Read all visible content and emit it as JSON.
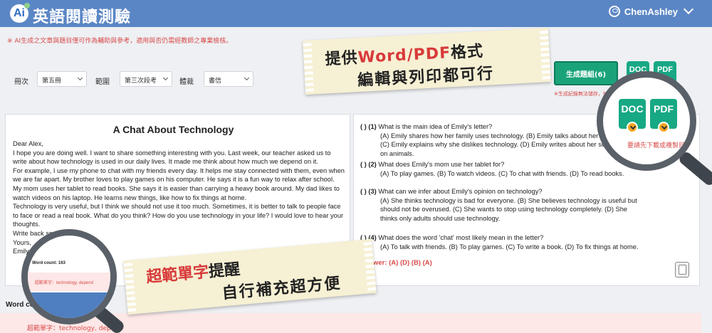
{
  "header": {
    "logo_text": "Ai",
    "title": "英語閱讀測驗",
    "username": "ChenAshley"
  },
  "notice": "※ AI生成之文章與題目僅可作為輔助與參考，適用與否仍需經教師之專業檢核。",
  "filters": [
    {
      "label": "冊次",
      "value": "第五冊"
    },
    {
      "label": "範圍",
      "value": "第三次段考"
    },
    {
      "label": "體裁",
      "value": "書信"
    }
  ],
  "generate": {
    "label": "生成題組(6)",
    "note": "※生成紀錄無法儲存，如有需要請先下載或複製目前內容。"
  },
  "downloads": {
    "doc": "DOC",
    "pdf": "PDF"
  },
  "lens_text": {
    "download_note": "要請先下載或複製目",
    "word_count": "Word count: 163",
    "vocab": "超範單字：technology, depend"
  },
  "article": {
    "title": "A Chat About Technology",
    "paragraphs": [
      "Dear Alex,",
      "I hope you are doing well. I want to share something interesting with you. Last week, our teacher asked us to write about how technology is used in our daily lives. It made me think about how much we depend on it.",
      "For example, I use my phone to chat with my friends every day. It helps me stay connected with them, even when we are far apart. My brother loves to play games on his computer. He says it is a fun way to relax after school. My mom uses her tablet to read books. She says it is easier than carrying a heavy book around. My dad likes to watch videos on his laptop. He learns new things, like how to fix things at home.",
      "Technology is very useful, but I think we should not use it too much. Sometimes, it is better to talk to people face to face or read a real book. What do you think? How do you use technology in your life? I would love to hear your thoughts.",
      "Write back soon!",
      "Yours,",
      "Emily"
    ]
  },
  "questions": [
    {
      "num": "( ) (1)",
      "q": "What is the main idea of Emily's letter?",
      "opts": "(A) Emily shares how her family uses technology. (B) Emily talks about her favorite game. (C) Emily explains why she dislikes technology. (D) Emily writes about her school project on animals."
    },
    {
      "num": "( ) (2)",
      "q": "What does Emily's mom use her tablet for?",
      "opts": "(A) To play games. (B) To watch videos. (C) To chat with friends. (D) To read books."
    },
    {
      "num": "( ) (3)",
      "q": "What can we infer about Emily's opinion on technology?",
      "opts": "(A) She thinks technology is bad for everyone. (B) She believes technology is useful but should not be overused. (C) She wants to stop using technology completely. (D) She thinks only adults should use technology."
    },
    {
      "num": "( ) (4)",
      "q": "What does the word 'chat' most likely mean in the letter?",
      "opts": "(A) To talk with friends. (B) To play games. (C) To write a book. (D) To fix things at home."
    }
  ],
  "answer": "Answer: (A) (D) (B) (A)",
  "word_count_label": "Word count: 163",
  "vocab_label": "超範單字：technology, depend",
  "banner1": {
    "line1_a": "提供",
    "line1_b": "Word/PDF",
    "line1_c": "格式",
    "line2": "編輯與列印都可行"
  },
  "banner2": {
    "line1_a": "超範單字",
    "line1_b": "提醒",
    "line2": "自行補充超方便"
  }
}
